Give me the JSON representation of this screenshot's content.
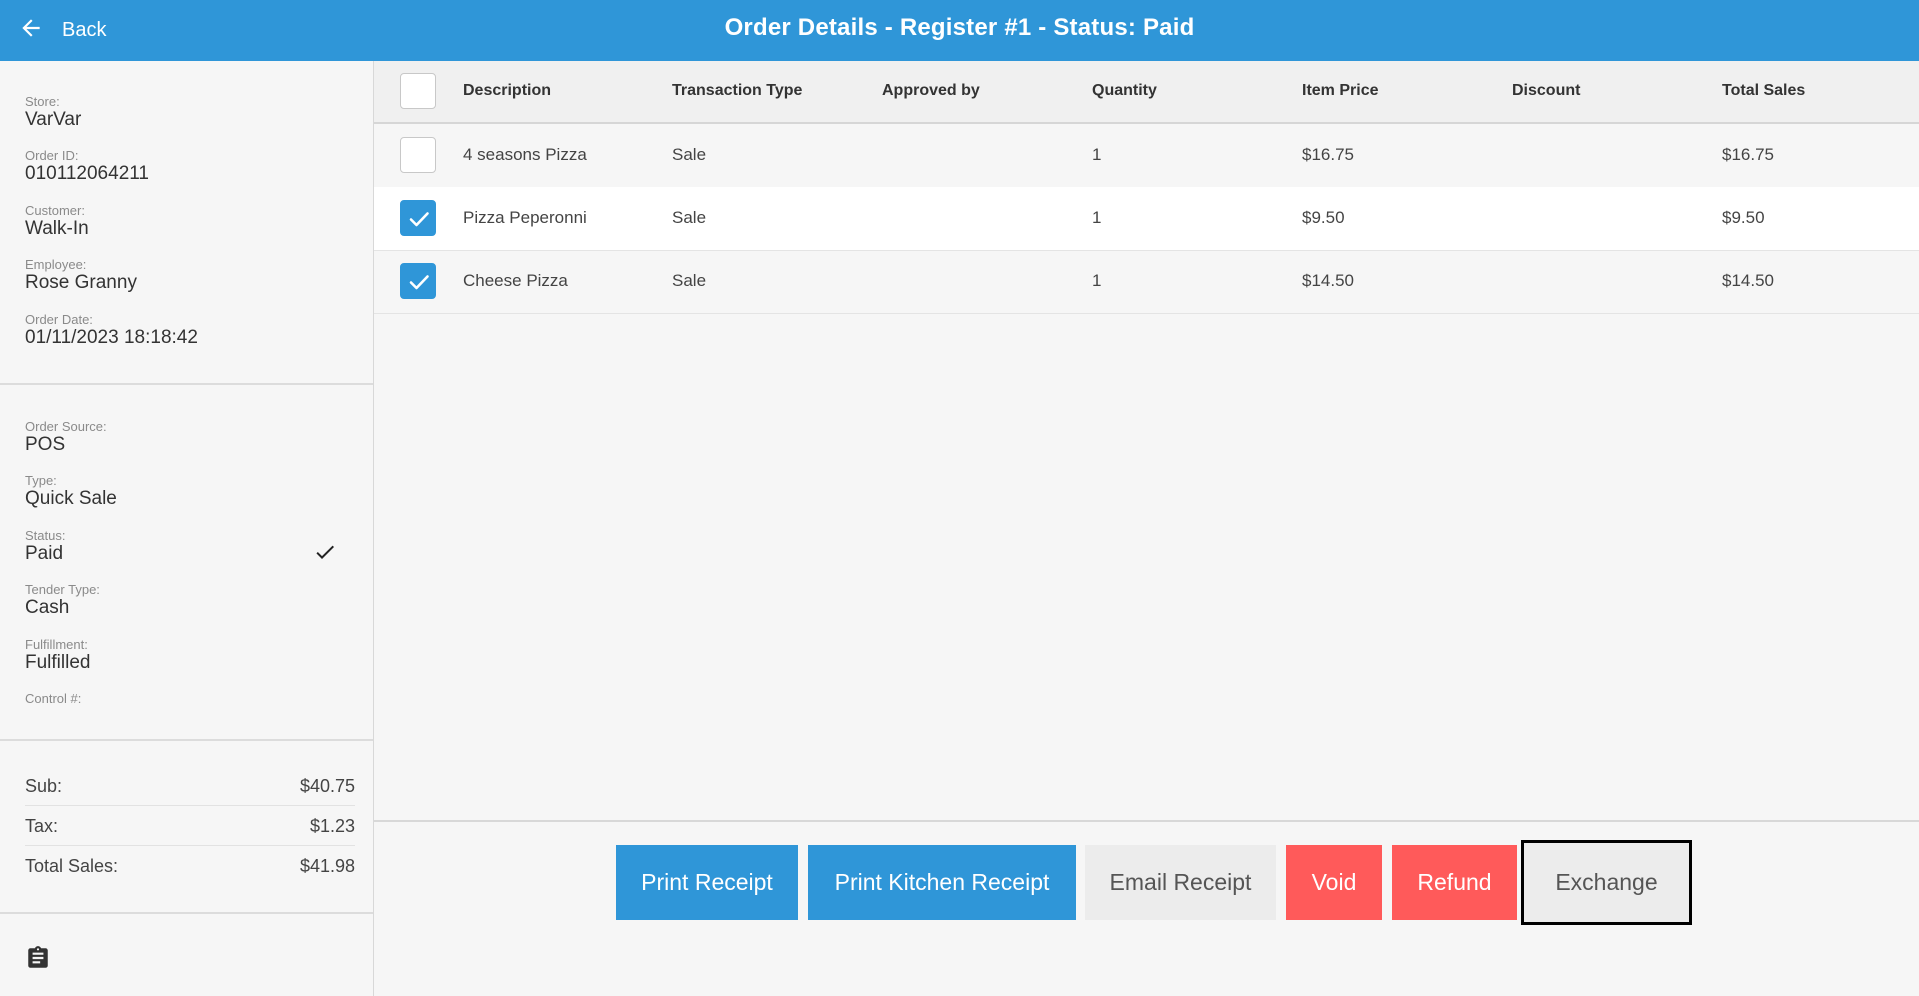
{
  "header": {
    "back_label": "Back",
    "title": "Order Details - Register #1 - Status: Paid",
    "color": "#2f96d8"
  },
  "order_info": {
    "store_label": "Store:",
    "store": "VarVar",
    "order_id_label": "Order ID:",
    "order_id": "010112064211",
    "customer_label": "Customer:",
    "customer": "Walk-In",
    "employee_label": "Employee:",
    "employee": "Rose Granny",
    "date_label": "Order Date:",
    "date": "01/11/2023 18:18:42"
  },
  "order_meta": {
    "source_label": "Order Source:",
    "source": "POS",
    "type_label": "Type:",
    "type": "Quick Sale",
    "status_label": "Status:",
    "status": "Paid",
    "tender_label": "Tender Type:",
    "tender": "Cash",
    "fulfillment_label": "Fulfillment:",
    "fulfillment": "Fulfilled",
    "control_label": "Control #:"
  },
  "totals": {
    "sub_label": "Sub:",
    "sub": "$40.75",
    "tax_label": "Tax:",
    "tax": "$1.23",
    "total_label": "Total Sales:",
    "total": "$41.98"
  },
  "table": {
    "headers": {
      "description": "Description",
      "transaction_type": "Transaction Type",
      "approved_by": "Approved by",
      "quantity": "Quantity",
      "item_price": "Item Price",
      "discount": "Discount",
      "total_sales": "Total Sales"
    },
    "rows": [
      {
        "checked": false,
        "description": "4 seasons Pizza",
        "transaction_type": "Sale",
        "approved_by": "",
        "quantity": "1",
        "item_price": "$16.75",
        "discount": "",
        "total_sales": "$16.75"
      },
      {
        "checked": true,
        "description": "Pizza Peperonni",
        "transaction_type": "Sale",
        "approved_by": "",
        "quantity": "1",
        "item_price": "$9.50",
        "discount": "",
        "total_sales": "$9.50"
      },
      {
        "checked": true,
        "description": "Cheese Pizza",
        "transaction_type": "Sale",
        "approved_by": "",
        "quantity": "1",
        "item_price": "$14.50",
        "discount": "",
        "total_sales": "$14.50"
      }
    ]
  },
  "actions": {
    "print_receipt": "Print Receipt",
    "print_kitchen_receipt": "Print Kitchen Receipt",
    "email_receipt": "Email Receipt",
    "void": "Void",
    "refund": "Refund",
    "exchange": "Exchange"
  },
  "icons": {
    "back": "arrow-left-icon",
    "status_check": "check-icon",
    "notes": "clipboard-icon"
  }
}
